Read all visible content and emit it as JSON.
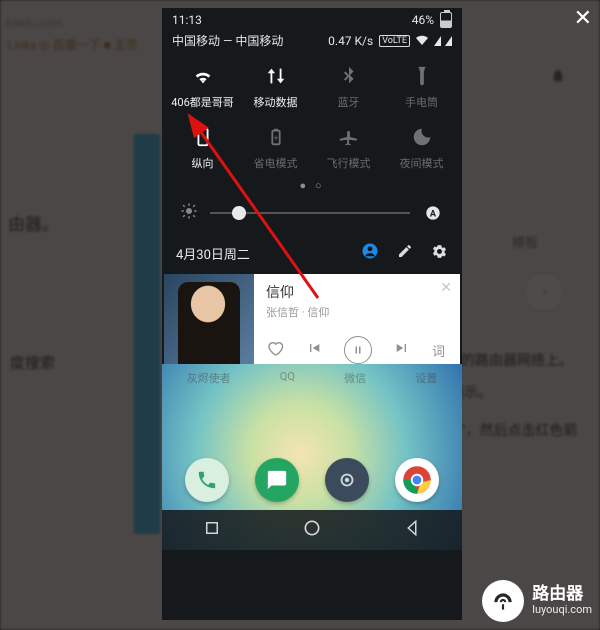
{
  "bg": {
    "addr": "baidu.com",
    "links": "Links  ◎ 百度一下  ■ 主页",
    "txt1": "由器。",
    "txt2": "度搜索",
    "txt3": "的路由器网络上。",
    "txt4": "例演示。",
    "txt5": "\"，然后点击红色箭",
    "mb": "模板"
  },
  "statusbar": {
    "time": "11:13",
    "battery_pct": "46%",
    "volte": "VoLTE"
  },
  "carrier": {
    "left": "中国移动 — 中国移动",
    "speed": "0.47 K/s"
  },
  "tiles": [
    {
      "label": "406都是哥哥",
      "active": true,
      "icon": "wifi"
    },
    {
      "label": "移动数据",
      "active": true,
      "icon": "data"
    },
    {
      "label": "蓝牙",
      "active": false,
      "icon": "bt"
    },
    {
      "label": "手电筒",
      "active": false,
      "icon": "torch"
    },
    {
      "label": "纵向",
      "active": true,
      "icon": "portrait"
    },
    {
      "label": "省电模式",
      "active": false,
      "icon": "battery"
    },
    {
      "label": "飞行模式",
      "active": false,
      "icon": "plane"
    },
    {
      "label": "夜间模式",
      "active": false,
      "icon": "moon"
    }
  ],
  "date": "4月30日周二",
  "music": {
    "title": "信仰",
    "subtitle": "张信哲 · 信仰",
    "lyric": "词"
  },
  "dock_labels": [
    "灰烬使者",
    "QQ",
    "微信",
    "设置"
  ],
  "watermark": {
    "l1": "路由器",
    "l2": "luyouqi.com"
  }
}
